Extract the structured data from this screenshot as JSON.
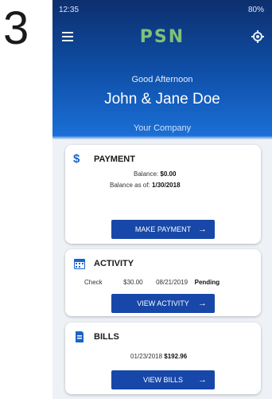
{
  "step_number": "3",
  "status_bar": {
    "time": "12:35",
    "battery": "80%"
  },
  "app": {
    "logo_text": "PSN"
  },
  "greeting": "Good Afternoon",
  "user_name": "John & Jane Doe",
  "company": "Your Company",
  "payment": {
    "title": "PAYMENT",
    "balance_label": "Balance:",
    "balance_value": "$0.00",
    "balance_asof_label": "Balance as of:",
    "balance_asof_value": "1/30/2018",
    "button": "MAKE PAYMENT"
  },
  "activity": {
    "title": "ACTIVITY",
    "type": "Check",
    "amount": "$30.00",
    "date": "08/21/2019",
    "status": "Pending",
    "button": "VIEW ACTIVITY"
  },
  "bills": {
    "title": "BILLS",
    "date": "01/23/2018",
    "amount": "$192.96",
    "button": "VIEW BILLS"
  },
  "colors": {
    "primary_button": "#1747a8",
    "header_top": "#0d2f6e",
    "header_bottom": "#1a6fd6",
    "accent_icon": "#1c64c8"
  }
}
